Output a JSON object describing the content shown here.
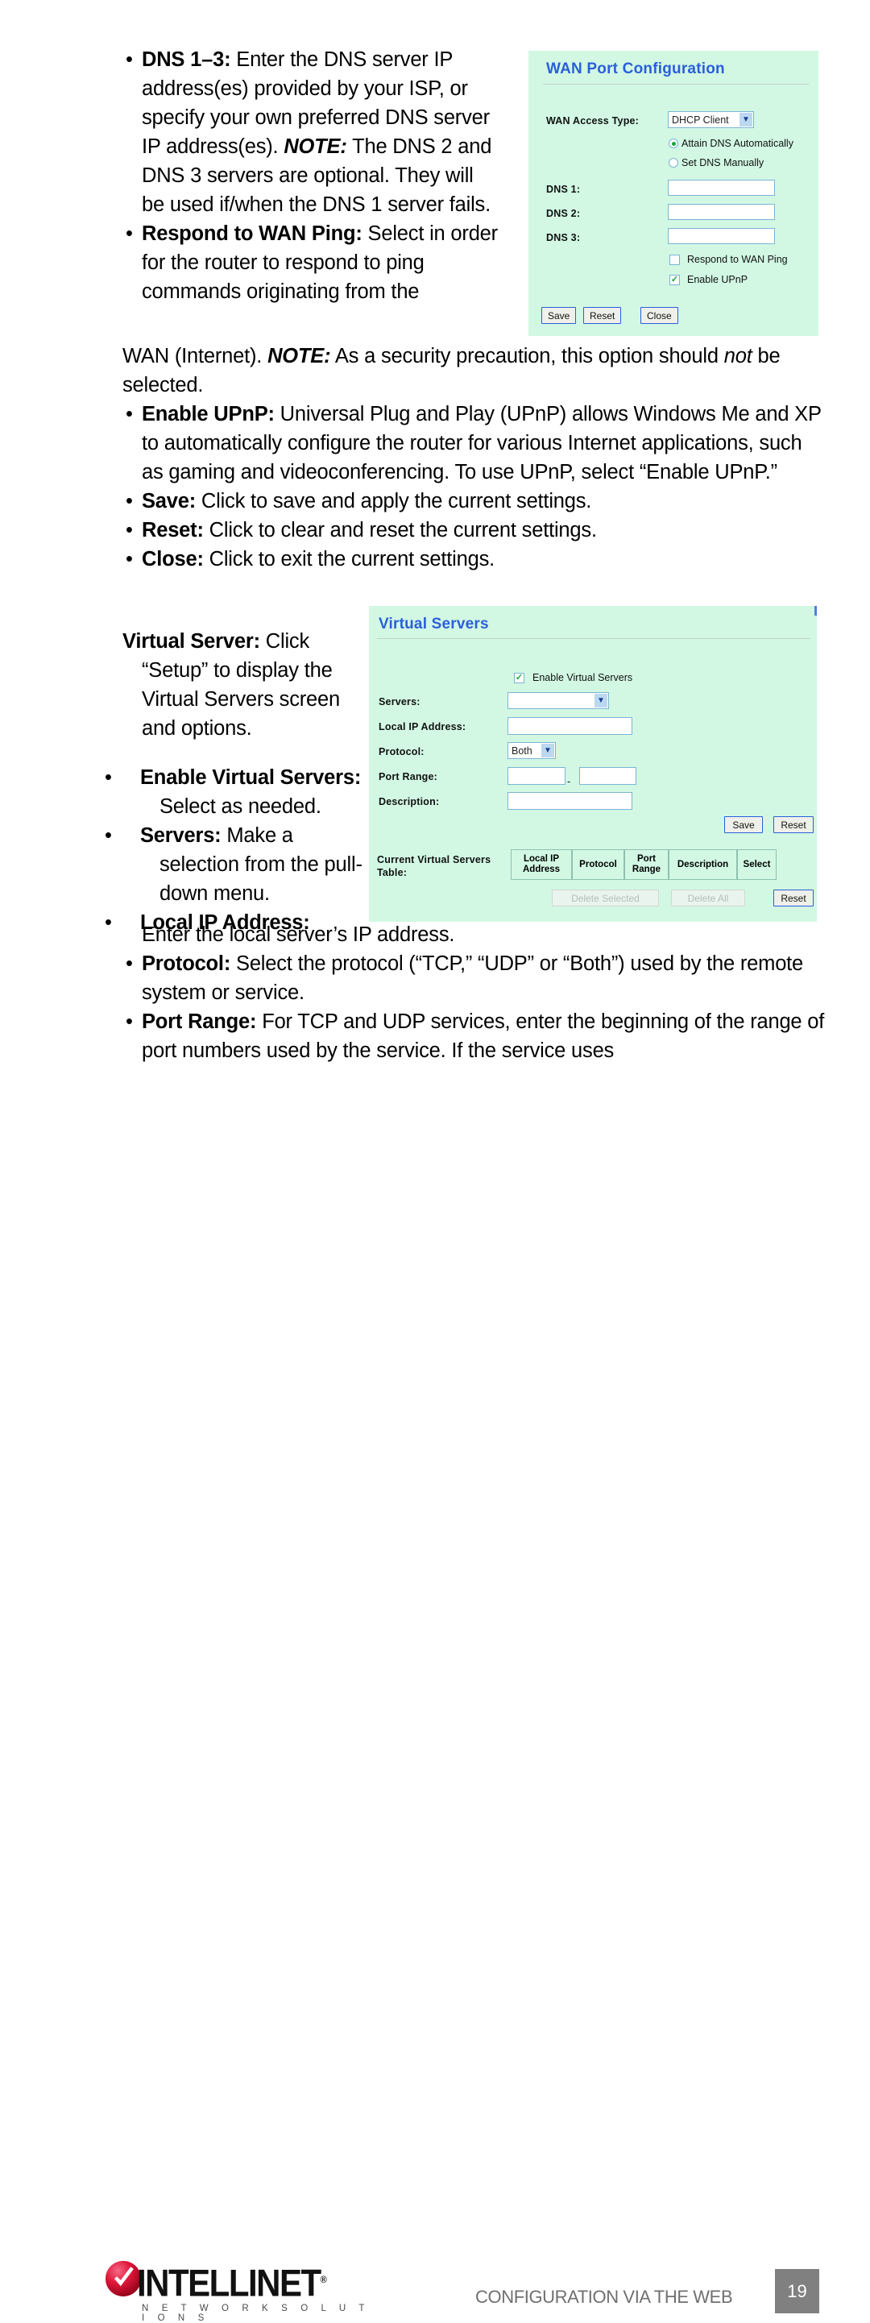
{
  "document": {
    "page_number": "19",
    "footer_title": "CONFIGURATION VIA THE WEB",
    "logo": {
      "wordmark": "INTELLINET",
      "tagline": "N E T W O R K   S O L U T I O N S"
    }
  },
  "body": {
    "top_column": {
      "item1": {
        "term": "DNS 1–3:",
        "text_a": " Enter the DNS server IP address(es) provided by your ISP, or specify your own preferred DNS server IP address(es). ",
        "note": "NOTE:",
        "text_b": " The DNS 2 and DNS 3 servers are optional. They will be used if/when the DNS 1 server fails."
      },
      "item2": {
        "term": "Respond to WAN Ping:",
        "text": " Select in order for the router to respond to ping commands originating from the"
      }
    },
    "mid_column": {
      "item2_cont_a": "WAN (Internet). ",
      "item2_note": "NOTE:",
      "item2_cont_b": " As a security precaution, this option should ",
      "item2_not": "not",
      "item2_cont_c": " be selected.",
      "item3": {
        "term": "Enable UPnP:",
        "text": " Universal Plug and Play (UPnP) allows Windows Me and XP to automatically configure the router for various Internet applications, such as gaming and videoconferencing. To use UPnP, select “Enable UPnP.”"
      },
      "item4": {
        "term": "Save:",
        "text": " Click to save and apply the current settings."
      },
      "item5": {
        "term": "Reset:",
        "text": " Click to clear and reset the current settings."
      },
      "item6": {
        "term": "Close:",
        "text": " Click to exit the current settings."
      }
    },
    "vs_column": {
      "heading_term": "Virtual Server:",
      "heading_text": " Click “Setup” to display the Virtual Servers screen and options.",
      "item1": {
        "term": "Enable Virtual Servers:",
        "text": " Select as needed."
      },
      "item2": {
        "term": "Servers:",
        "text": " Make a selection from the pull-down menu."
      },
      "item3_term": "Local IP Address:"
    },
    "bottom_column": {
      "item3_text": "Enter the local server’s IP address.",
      "item4": {
        "term": "Protocol:",
        "text": " Select the protocol (“TCP,” “UDP” or “Both”) used by the remote system or service."
      },
      "item5": {
        "term": "Port Range:",
        "text": " For TCP and UDP services, enter the beginning of the range of port numbers used by the service. If the service uses"
      }
    }
  },
  "wan_panel": {
    "title": "WAN Port Configuration",
    "access_type_label": "WAN Access Type:",
    "access_type_value": "DHCP Client",
    "radio_attain": "Attain DNS Automatically",
    "radio_manual": "Set DNS Manually",
    "dns1_label": "DNS 1:",
    "dns2_label": "DNS 2:",
    "dns3_label": "DNS 3:",
    "dns1_value": "",
    "dns2_value": "",
    "dns3_value": "",
    "check_wanping": "Respond to WAN Ping",
    "check_upnp": "Enable UPnP",
    "btn_save": "Save",
    "btn_reset": "Reset",
    "btn_close": "Close",
    "colors": {
      "panel_bg": "#d2f8e4",
      "title": "#2b5fd9",
      "accent_check": "#19a33a"
    }
  },
  "vs_panel": {
    "title": "Virtual Servers",
    "check_enable": "Enable Virtual Servers",
    "servers_label": "Servers:",
    "servers_value": "",
    "local_ip_label": "Local IP Address:",
    "local_ip_value": "",
    "protocol_label": "Protocol:",
    "protocol_value": "Both",
    "port_range_label": "Port Range:",
    "port_range_from": "",
    "port_range_to": "",
    "port_range_sep": "-",
    "description_label": "Description:",
    "description_value": "",
    "btn_save": "Save",
    "btn_reset": "Reset",
    "table_label_line1": "Current Virtual Servers",
    "table_label_line2": "Table:",
    "table_headers": [
      "Local IP\nAddress",
      "Protocol",
      "Port\nRange",
      "Description",
      "Select"
    ],
    "th_local_ip_1": "Local IP",
    "th_local_ip_2": "Address",
    "th_protocol": "Protocol",
    "th_port_1": "Port",
    "th_port_2": "Range",
    "th_description": "Description",
    "th_select": "Select",
    "btn_delete_selected": "Delete Selected",
    "btn_delete_all": "Delete All",
    "btn_reset2": "Reset"
  }
}
